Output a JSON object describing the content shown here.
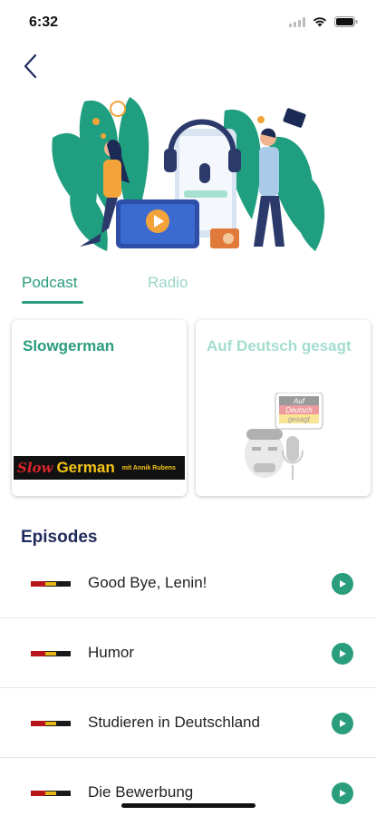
{
  "status_bar": {
    "time": "6:32",
    "icons": [
      "signal-icon",
      "wifi-icon",
      "battery-icon"
    ]
  },
  "nav": {
    "back_icon": "chevron-left-icon"
  },
  "hero": {
    "illustration": "podcast-illustration"
  },
  "tabs": [
    {
      "label": "Podcast",
      "active": true
    },
    {
      "label": "Radio",
      "active": false
    }
  ],
  "podcasts": [
    {
      "title": "Slowgerman",
      "logo": {
        "slow": "Slow",
        "german": "German",
        "subtitle": "mit Annik Rubens"
      }
    },
    {
      "title": "Auf Deutsch gesagt",
      "logo": {
        "line1": "Auf",
        "line2": "Deutsch",
        "line3": "gesagt"
      }
    }
  ],
  "episodes": {
    "heading": "Episodes",
    "items": [
      {
        "title": "Good Bye, Lenin!"
      },
      {
        "title": "Humor"
      },
      {
        "title": "Studieren in Deutschland"
      },
      {
        "title": "Die Bewerbung"
      }
    ]
  },
  "colors": {
    "accent": "#2a9d7c",
    "accent_light": "#98d6c6",
    "heading": "#1f2a5c"
  }
}
